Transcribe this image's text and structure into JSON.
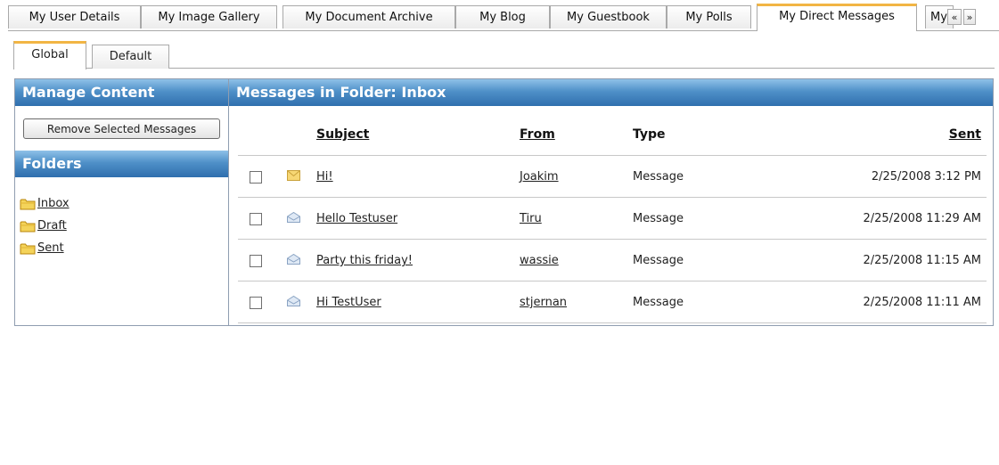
{
  "top_tabs": [
    {
      "label": "My User Details"
    },
    {
      "label": "My Image Gallery"
    },
    {
      "label": "My Document Archive"
    },
    {
      "label": "My Blog"
    },
    {
      "label": "My Guestbook"
    },
    {
      "label": "My Polls"
    },
    {
      "label": "My Direct Messages",
      "active": true
    },
    {
      "label": "My"
    }
  ],
  "scroll_buttons": {
    "left": "«",
    "right": "»"
  },
  "sub_tabs": [
    {
      "label": "Global",
      "active": true
    },
    {
      "label": "Default"
    }
  ],
  "manage": {
    "title": "Manage Content",
    "remove_button": "Remove Selected Messages",
    "folders_title": "Folders",
    "folders": [
      {
        "label": "Inbox"
      },
      {
        "label": "Draft"
      },
      {
        "label": "Sent"
      }
    ]
  },
  "messages": {
    "title": "Messages in Folder: Inbox",
    "columns": {
      "subject": "Subject",
      "from": "From",
      "type": "Type",
      "sent": "Sent"
    },
    "rows": [
      {
        "subject": "Hi!",
        "from": "Joakim",
        "type": "Message",
        "sent": "2/25/2008 3:12 PM",
        "icon": "envelope-closed-icon"
      },
      {
        "subject": "Hello Testuser",
        "from": "Tiru",
        "type": "Message",
        "sent": "2/25/2008 11:29 AM",
        "icon": "envelope-open-icon"
      },
      {
        "subject": "Party this friday!",
        "from": "wassie",
        "type": "Message",
        "sent": "2/25/2008 11:15 AM",
        "icon": "envelope-open-icon"
      },
      {
        "subject": "Hi TestUser",
        "from": "stjernan",
        "type": "Message",
        "sent": "2/25/2008 11:11 AM",
        "icon": "envelope-open-icon"
      }
    ]
  },
  "colors": {
    "accent": "#f2b544",
    "header_top": "#8fc1e8",
    "header_bottom": "#2f6fae"
  }
}
